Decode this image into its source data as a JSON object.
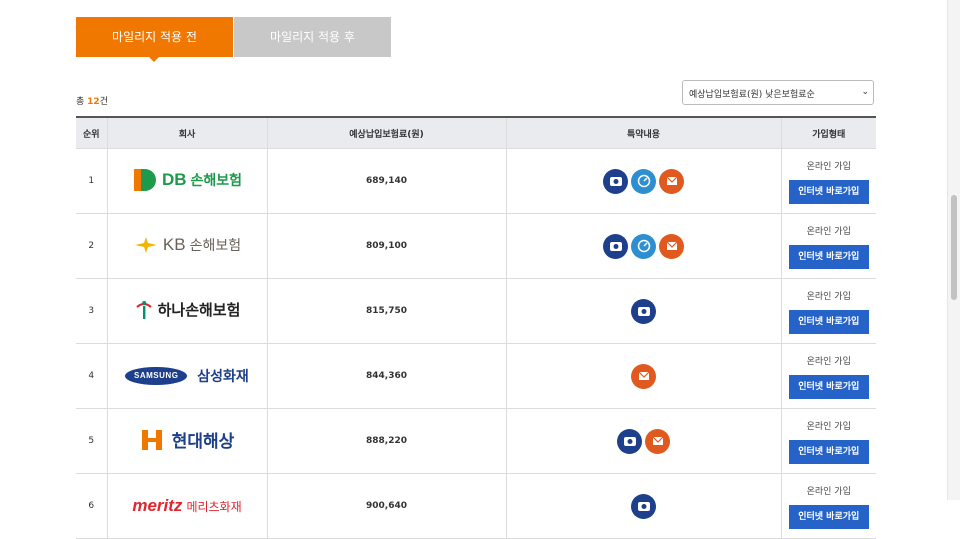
{
  "tabs": [
    {
      "label": "마일리지 적용 전",
      "active": true
    },
    {
      "label": "마일리지 적용 후",
      "active": false
    }
  ],
  "total": {
    "prefix": "총",
    "count": "12",
    "suffix": "건"
  },
  "sort": {
    "selected": "예상납입보험료(원) 낮은보험료순"
  },
  "table": {
    "headers": [
      "순위",
      "회사",
      "예상납입보험료(원)",
      "특약내용",
      "가입형태"
    ],
    "rows": [
      {
        "rank": "1",
        "company": "DB손해보험",
        "logo_prefix": "DB",
        "logo_name": "손해보험",
        "price": "689,140",
        "icons": [
          "camera-icon",
          "speedometer-icon",
          "mail-icon"
        ],
        "join_type": "온라인 가입",
        "join_button": "인터넷 바로가입"
      },
      {
        "rank": "2",
        "company": "KB손해보험",
        "logo_prefix": "KB",
        "logo_name": "손해보험",
        "price": "809,100",
        "icons": [
          "camera-icon",
          "speedometer-icon",
          "mail-icon"
        ],
        "join_type": "온라인 가입",
        "join_button": "인터넷 바로가입"
      },
      {
        "rank": "3",
        "company": "하나손해보험",
        "logo_prefix": "",
        "logo_name": "하나손해보험",
        "price": "815,750",
        "icons": [
          "camera-icon"
        ],
        "join_type": "온라인 가입",
        "join_button": "인터넷 바로가입"
      },
      {
        "rank": "4",
        "company": "삼성화재",
        "logo_prefix": "SAMSUNG",
        "logo_name": "삼성화재",
        "price": "844,360",
        "icons": [
          "mail-icon"
        ],
        "join_type": "온라인 가입",
        "join_button": "인터넷 바로가입"
      },
      {
        "rank": "5",
        "company": "현대해상",
        "logo_prefix": "",
        "logo_name": "현대해상",
        "price": "888,220",
        "icons": [
          "camera-icon",
          "mail-icon"
        ],
        "join_type": "온라인 가입",
        "join_button": "인터넷 바로가입"
      },
      {
        "rank": "6",
        "company": "메리츠화재",
        "logo_prefix": "meritz",
        "logo_name": "메리츠화재",
        "price": "900,640",
        "icons": [
          "camera-icon"
        ],
        "join_type": "온라인 가입",
        "join_button": "인터넷 바로가입"
      }
    ]
  },
  "colors": {
    "accent": "#f07800",
    "button": "#2563c9",
    "icon_navy": "#1d3f8c",
    "icon_sky": "#2d8fd0",
    "icon_orange": "#e05a20"
  }
}
